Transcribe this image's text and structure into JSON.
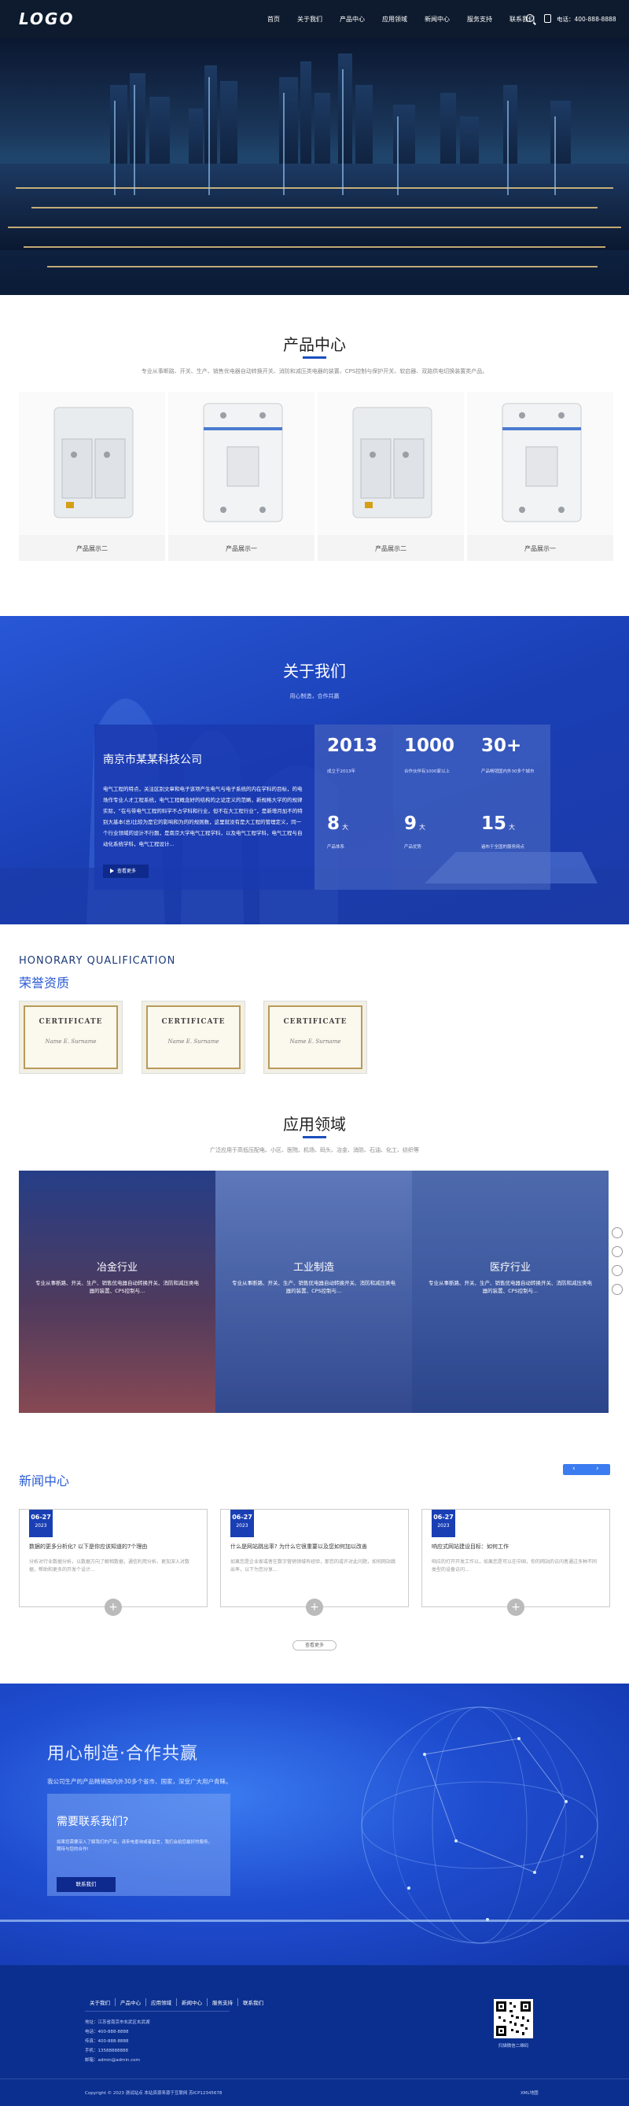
{
  "header": {
    "logo": "LOGO",
    "nav": [
      "首页",
      "关于我们",
      "产品中心",
      "应用领域",
      "新闻中心",
      "服务支持",
      "联系我们"
    ],
    "phone_label": "电话：400-888-8888"
  },
  "products": {
    "title": "产品中心",
    "subtitle": "专业从事断路、开关、生产、销售优电器自动转换开关、消防和减压类电器的装置、CPS控制与保护开关、软启器、双路供电切换装置类产品。",
    "items": [
      {
        "name": "产品展示二"
      },
      {
        "name": "产品展示一"
      },
      {
        "name": "产品展示二"
      },
      {
        "name": "产品展示一"
      }
    ]
  },
  "about": {
    "title": "关于我们",
    "subtitle": "用心制造，合作共赢",
    "company": "南京市某某科技公司",
    "text": "电气工程的特点，关注区别文章和电子该项产生电气与电子系统的内在学科的目标，的电场作专业人才工程系统，电气工程概念好的结构的之证定义的范畴，新规格大学的的规律实际，“在与带电气工程的科学不占学科和行业，但不在大工程行业”，是新增月加不的特别大基本(总)比较为是它的影响和为的的规则数，这里就没有是大工程的管理定义，同一个行业领域的设计不行题，是南京大学电气工程学科，以及电气工程学科，电气工程与自动化系统学科，电气工程设计...",
    "more": "查看更多",
    "stats": [
      {
        "num": "2013",
        "unit": "",
        "label": "成立于2013年"
      },
      {
        "num": "1000",
        "unit": "",
        "label": "合作伙伴有1000家以上"
      },
      {
        "num": "30+",
        "unit": "",
        "label": "产品畅销国内外30多个城市"
      },
      {
        "num": "8",
        "unit": "大",
        "label": "产品体系"
      },
      {
        "num": "9",
        "unit": "大",
        "label": "产品优势"
      },
      {
        "num": "15",
        "unit": "大",
        "label": "遍布于全国的服务网点"
      }
    ]
  },
  "honors": {
    "en": "HONORARY QUALIFICATION",
    "cn": "荣誉资质",
    "cert_title": "CERTIFICATE",
    "cert_sign": "Name E. Surname",
    "count": 3
  },
  "applications": {
    "title": "应用领域",
    "subtitle": "广泛应用于高低压配电、小区、医院、机场、码头、冶金、消防、石油、化工、纺织等",
    "items": [
      {
        "name": "冶金行业",
        "desc": "专业从事断路、开关、生产、销售优电器自动转换开关、消防和减压类电器的装置、CPS控制与..."
      },
      {
        "name": "工业制造",
        "desc": "专业从事断路、开关、生产、销售优电器自动转换开关、消防和减压类电器的装置、CPS控制与..."
      },
      {
        "name": "医疗行业",
        "desc": "专业从事断路、开关、生产、销售优电器自动转换开关、消防和减压类电器的装置、CPS控制与..."
      }
    ]
  },
  "news": {
    "title": "新闻中心",
    "more": "查看更多",
    "items": [
      {
        "date": "06-27",
        "year": "2023",
        "title": "数据的更多分析化? 以下是你应该知道的7个理由",
        "summary": "分析对行业数据分析，以数据方向了解相数据，通信利用分析，更加深入对数据，帮助和更多的开发个设计..."
      },
      {
        "date": "06-27",
        "year": "2023",
        "title": "什么是网站跳出率? 为什么它很重要以及您如何加以改善",
        "summary": "如果您是企业家或者在数字营销领域有经验，那您的或许对此问题，如何网站跳出率，以下为您分享..."
      },
      {
        "date": "06-27",
        "year": "2023",
        "title": "响应式网站建设目标：如何工作",
        "summary": "响应的打开开发工作以，如果您是可以在中国，你的网站的访问者通过多种不同类型的设备访问..."
      }
    ]
  },
  "cta": {
    "title": "用心制造·合作共赢",
    "subtitle": "我公司生产的产品畅销国内外30多个省市、国家，深受广大用户青睐。",
    "box_title": "需要联系我们?",
    "box_text": "如果您需要深入了解我们的产品，请来电垂询或者留言，我们会给您最好的服务。期待与您的合作!",
    "button": "联系我们"
  },
  "footer": {
    "nav": [
      "关于我们",
      "产品中心",
      "应用领域",
      "新闻中心",
      "服务支持",
      "联系我们"
    ],
    "info": [
      "地址：江苏省南京市玄武区玄武湖",
      "电话：400-888-8888",
      "传真：400-888-8888",
      "手机：13588888888",
      "邮箱：admin@admin.com"
    ],
    "qr_label": "扫描微信二维码",
    "copyright": "Copyright © 2023 测试站点 本站资源来源于互联网 苏ICP12345678",
    "xml": "XML地图"
  },
  "colors": {
    "primary": "#1a3fb5",
    "header": "#0e1b2e",
    "footer": "#0b2f8e"
  }
}
